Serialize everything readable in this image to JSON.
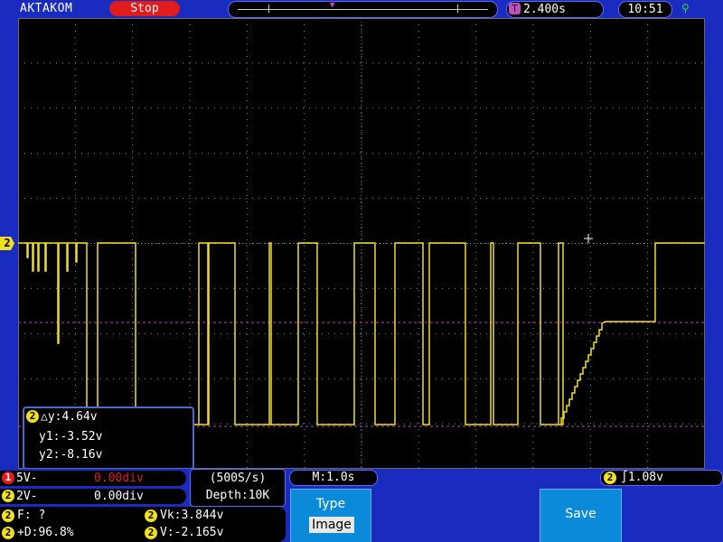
{
  "header": {
    "brand": "AKTAKOM",
    "run_state": "Stop",
    "trigger_time_icon": "T",
    "trigger_time": "2.400s",
    "clock": "10:51",
    "usb_icon": "usb-icon"
  },
  "channel_marker": "2",
  "cursors": {
    "channel": "2",
    "delta_y": "△y:4.64v",
    "y1": "y1:-3.52v",
    "y2": "y2:-8.16v"
  },
  "channels": [
    {
      "num": "1",
      "label": "5V-",
      "offset": "0.00div",
      "color": "#e01c1c"
    },
    {
      "num": "2",
      "label": "2V-",
      "offset": "0.00div",
      "color": "#f0e020"
    }
  ],
  "sampling": {
    "rate": "(500S/s)",
    "depth": "Depth:10K"
  },
  "timebase": "M:1.0s",
  "trigger": {
    "channel": "2",
    "level": "∫1.08v"
  },
  "measurements": {
    "freq": "F:  ?",
    "duty": "+D:96.8%",
    "vk": "Vk:3.844v",
    "v": "V:-2.165v",
    "channel": "2"
  },
  "softkeys": {
    "type_label": "Type",
    "type_value": "Image",
    "save_label": "Save"
  },
  "colors": {
    "trace": "#f0e020",
    "cursor": "#c040c0",
    "grid": "#888888",
    "panel": "#1a2bc0"
  }
}
